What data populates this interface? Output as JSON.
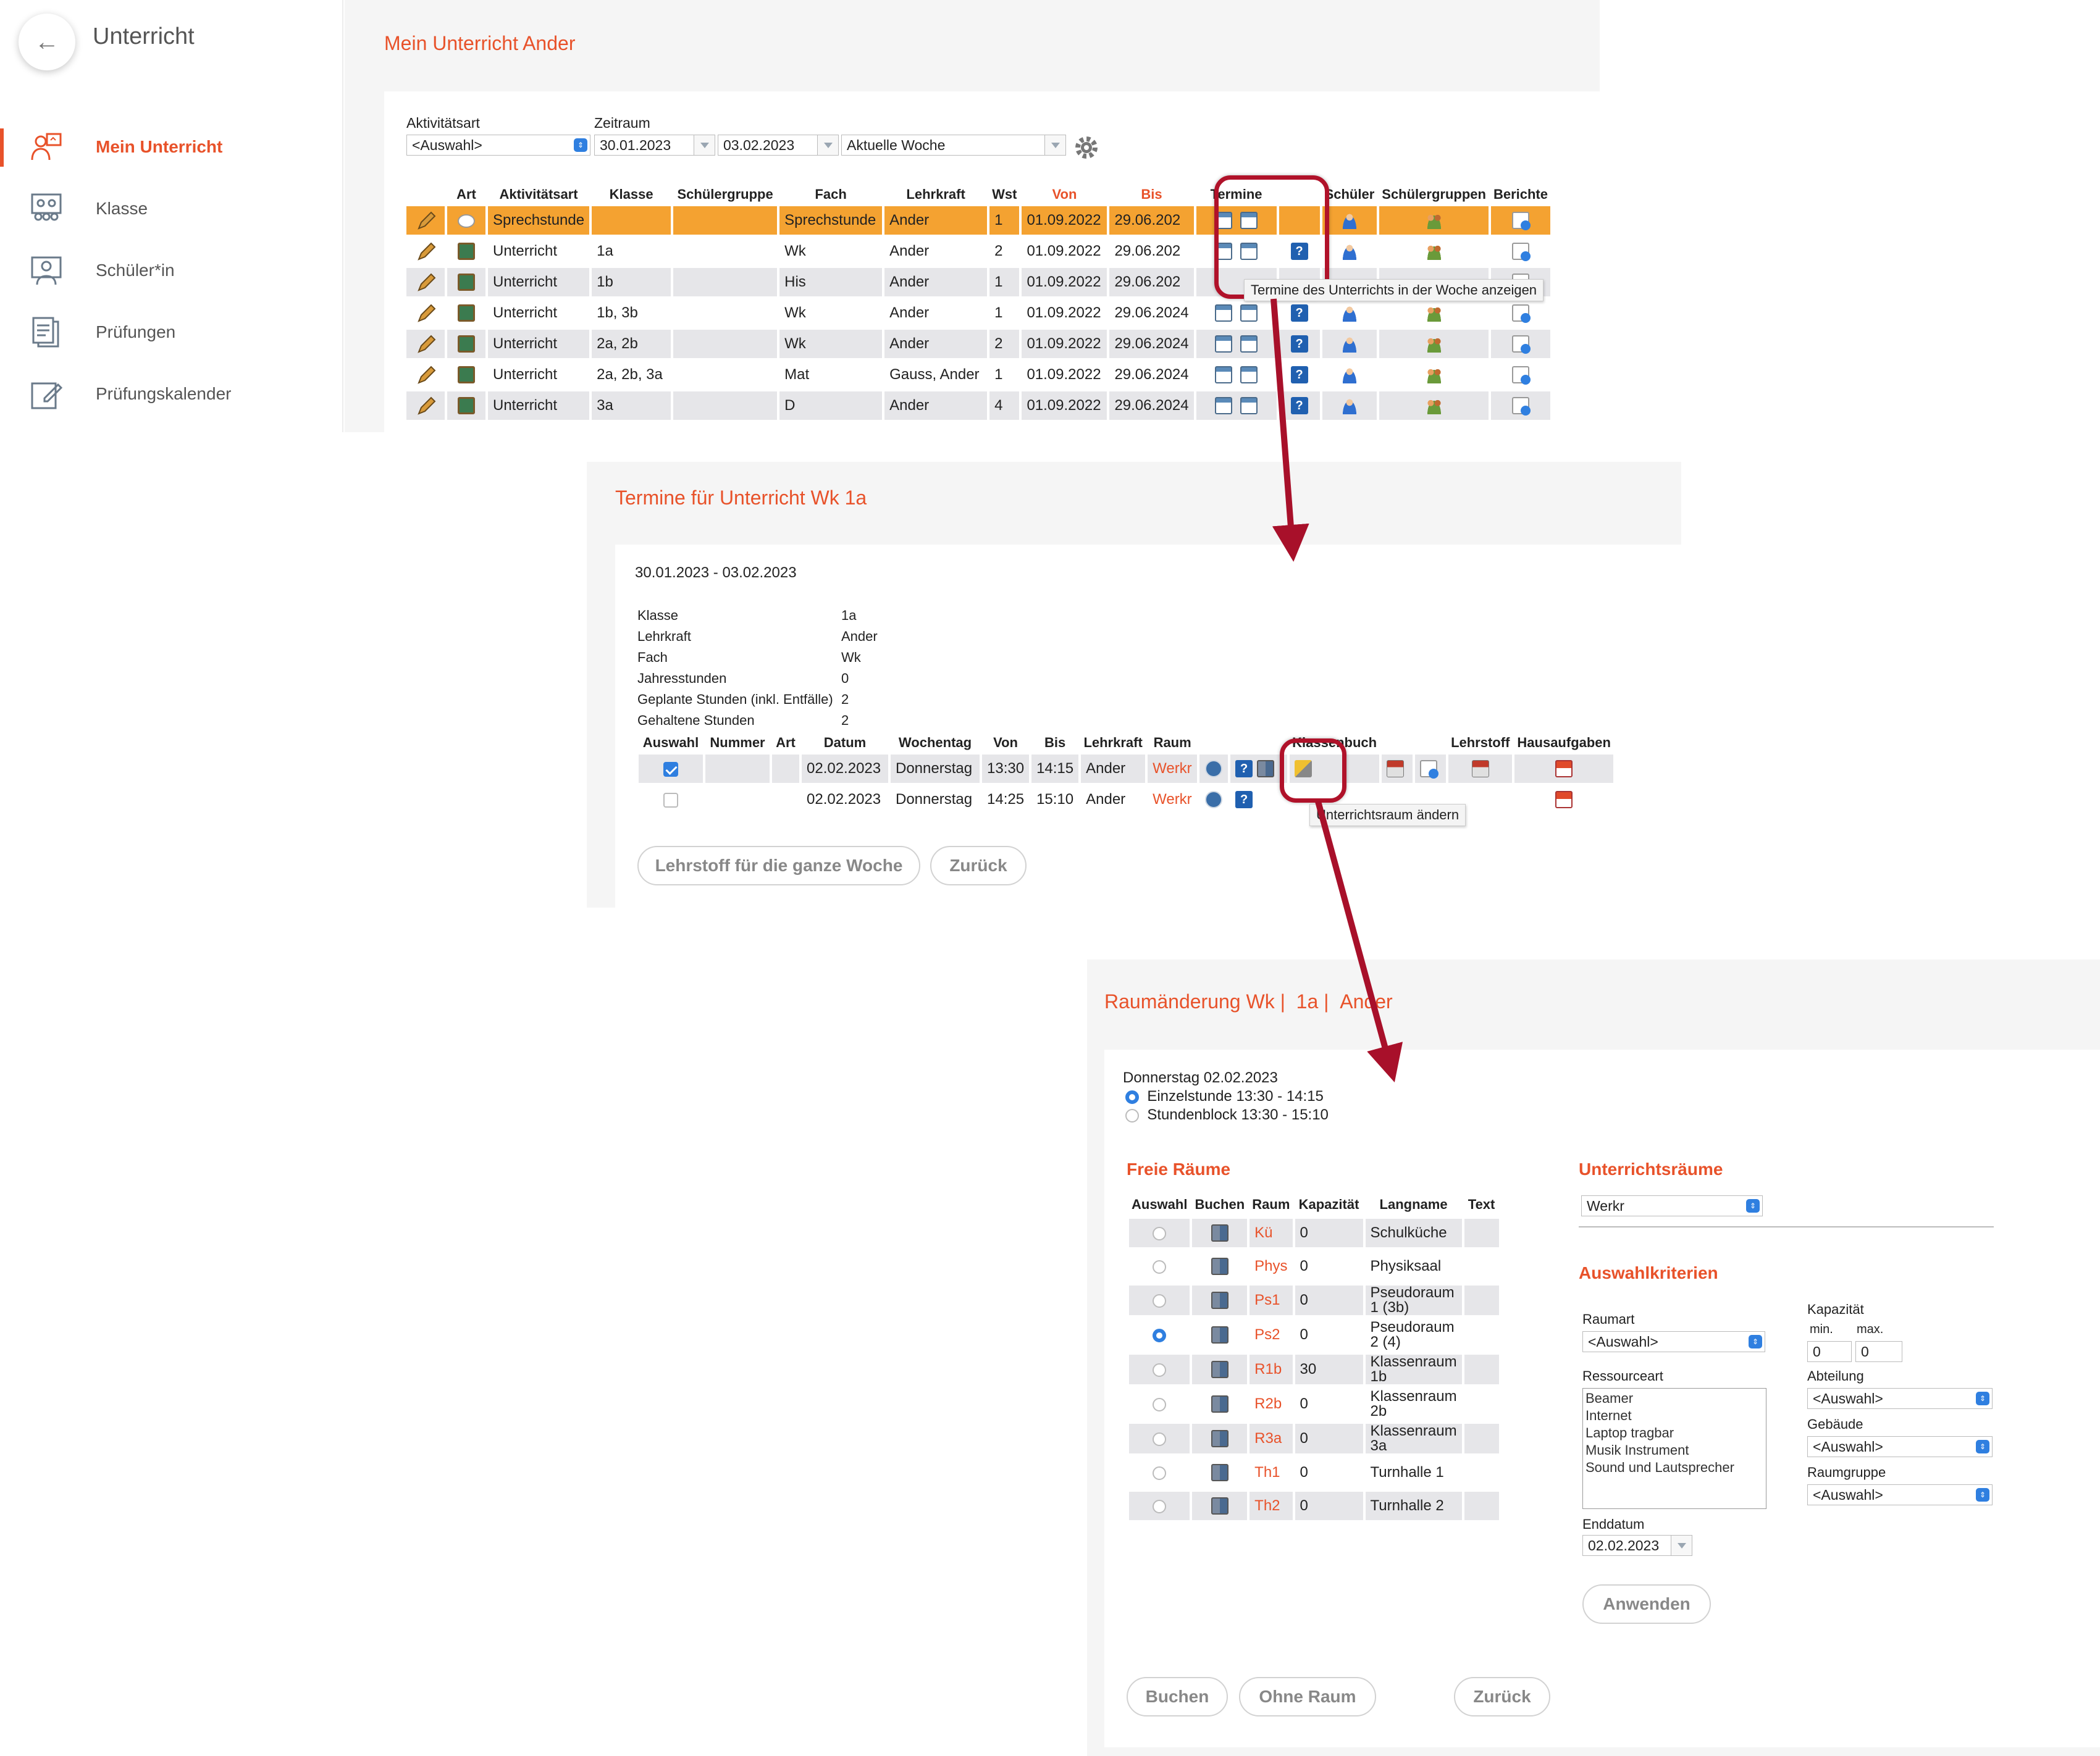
{
  "sidebar": {
    "title": "Unterricht",
    "items": [
      {
        "label": "Mein Unterricht",
        "active": true
      },
      {
        "label": "Klasse"
      },
      {
        "label": "Schüler*in"
      },
      {
        "label": "Prüfungen"
      },
      {
        "label": "Prüfungskalender"
      }
    ]
  },
  "panel1": {
    "title": "Mein Unterricht Ander",
    "aktivitaetsart_label": "Aktivitätsart",
    "aktivitaetsart_value": "<Auswahl>",
    "zeitraum_label": "Zeitraum",
    "date_from": "30.01.2023",
    "date_to": "03.02.2023",
    "period": "Aktuelle Woche",
    "headers": [
      "",
      "Art",
      "Aktivitätsart",
      "Klasse",
      "Schülergruppe",
      "Fach",
      "Lehrkraft",
      "Wst",
      "Von",
      "Bis",
      "Termine",
      "",
      "Schüler",
      "Schülergruppen",
      "Berichte"
    ],
    "rows": [
      {
        "art": "bubble",
        "aktivitaet": "Sprechstunde",
        "klasse": "",
        "gruppe": "",
        "fach": "Sprechstunde",
        "lehrkraft": "Ander",
        "wst": "1",
        "von": "01.09.2022",
        "bis": "29.06.202"
      },
      {
        "art": "board",
        "aktivitaet": "Unterricht",
        "klasse": "1a",
        "gruppe": "",
        "fach": "Wk",
        "lehrkraft": "Ander",
        "wst": "2",
        "von": "01.09.2022",
        "bis": "29.06.202"
      },
      {
        "art": "board",
        "aktivitaet": "Unterricht",
        "klasse": "1b",
        "gruppe": "",
        "fach": "His",
        "lehrkraft": "Ander",
        "wst": "1",
        "von": "01.09.2022",
        "bis": "29.06.202"
      },
      {
        "art": "board",
        "aktivitaet": "Unterricht",
        "klasse": "1b, 3b",
        "gruppe": "",
        "fach": "Wk",
        "lehrkraft": "Ander",
        "wst": "1",
        "von": "01.09.2022",
        "bis": "29.06.2024"
      },
      {
        "art": "board",
        "aktivitaet": "Unterricht",
        "klasse": "2a, 2b",
        "gruppe": "",
        "fach": "Wk",
        "lehrkraft": "Ander",
        "wst": "2",
        "von": "01.09.2022",
        "bis": "29.06.2024"
      },
      {
        "art": "board",
        "aktivitaet": "Unterricht",
        "klasse": "2a, 2b, 3a",
        "gruppe": "",
        "fach": "Mat",
        "lehrkraft": "Gauss, Ander",
        "wst": "1",
        "von": "01.09.2022",
        "bis": "29.06.2024"
      },
      {
        "art": "board",
        "aktivitaet": "Unterricht",
        "klasse": "3a",
        "gruppe": "",
        "fach": "D",
        "lehrkraft": "Ander",
        "wst": "4",
        "von": "01.09.2022",
        "bis": "29.06.2024"
      }
    ],
    "tooltip": "Termine des Unterrichts in der Woche anzeigen"
  },
  "panel2": {
    "title": "Termine für Unterricht Wk 1a",
    "range": "30.01.2023 - 03.02.2023",
    "info": [
      [
        "Klasse",
        "1a"
      ],
      [
        "Lehrkraft",
        "Ander"
      ],
      [
        "Fach",
        "Wk"
      ],
      [
        "Jahresstunden",
        "0"
      ],
      [
        "Geplante Stunden (inkl. Entfälle)",
        "2"
      ],
      [
        "Gehaltene Stunden",
        "2"
      ]
    ],
    "headers": [
      "Auswahl",
      "Nummer",
      "Art",
      "Datum",
      "Wochentag",
      "Von",
      "Bis",
      "Lehrkraft",
      "Raum",
      "",
      "",
      "Klassenbuch",
      "",
      "",
      "Lehrstoff",
      "Hausaufgaben"
    ],
    "rows": [
      {
        "checked": true,
        "datum": "02.02.2023",
        "tag": "Donnerstag",
        "von": "13:30",
        "bis": "14:15",
        "lehrkraft": "Ander",
        "raum": "Werkr"
      },
      {
        "checked": false,
        "datum": "02.02.2023",
        "tag": "Donnerstag",
        "von": "14:25",
        "bis": "15:10",
        "lehrkraft": "Ander",
        "raum": "Werkr"
      }
    ],
    "tooltip": "Unterrichtsraum ändern",
    "btn_week": "Lehrstoff für die ganze Woche",
    "btn_back": "Zurück"
  },
  "panel3": {
    "title_parts": [
      "Raumänderung Wk",
      "1a",
      "Ander"
    ],
    "date_line": "Donnerstag 02.02.2023",
    "opt1": "Einzelstunde 13:30 - 14:15",
    "opt2": "Stundenblock 13:30 - 15:10",
    "freie_title": "Freie Räume",
    "headers": [
      "Auswahl",
      "Buchen",
      "Raum",
      "Kapazität",
      "Langname",
      "Text"
    ],
    "rooms": [
      {
        "raum": "Kü",
        "kap": "0",
        "lang": "Schulküche"
      },
      {
        "raum": "Phys",
        "kap": "0",
        "lang": "Physiksaal"
      },
      {
        "raum": "Ps1",
        "kap": "0",
        "lang": "Pseudoraum 1 (3b)"
      },
      {
        "raum": "Ps2",
        "kap": "0",
        "lang": "Pseudoraum 2 (4)",
        "selected": true
      },
      {
        "raum": "R1b",
        "kap": "30",
        "lang": "Klassenraum 1b"
      },
      {
        "raum": "R2b",
        "kap": "0",
        "lang": "Klassenraum 2b"
      },
      {
        "raum": "R3a",
        "kap": "0",
        "lang": "Klassenraum 3a"
      },
      {
        "raum": "Th1",
        "kap": "0",
        "lang": "Turnhalle 1"
      },
      {
        "raum": "Th2",
        "kap": "0",
        "lang": "Turnhalle 2"
      }
    ],
    "ur_title": "Unterrichtsräume",
    "ur_value": "Werkr",
    "ak_title": "Auswahlkriterien",
    "raumart_label": "Raumart",
    "raumart_value": "<Auswahl>",
    "ressource_label": "Ressourceart",
    "ressources": [
      "Beamer",
      "Internet",
      "Laptop tragbar",
      "Musik Instrument",
      "Sound und Lautsprecher"
    ],
    "enddatum_label": "Enddatum",
    "enddatum_value": "02.02.2023",
    "kap_label": "Kapazität",
    "min_label": "min.",
    "max_label": "max.",
    "min_value": "0",
    "max_value": "0",
    "abteilung_label": "Abteilung",
    "abteilung_value": "<Auswahl>",
    "gebaeude_label": "Gebäude",
    "gebaeude_value": "<Auswahl>",
    "raumgruppe_label": "Raumgruppe",
    "raumgruppe_value": "<Auswahl>",
    "btn_apply": "Anwenden",
    "btn_book": "Buchen",
    "btn_noroom": "Ohne Raum",
    "btn_back": "Zurück"
  },
  "colors": {
    "accent": "#e8522a",
    "highlight_row": "#f4a231",
    "arrow": "#b0122a"
  }
}
